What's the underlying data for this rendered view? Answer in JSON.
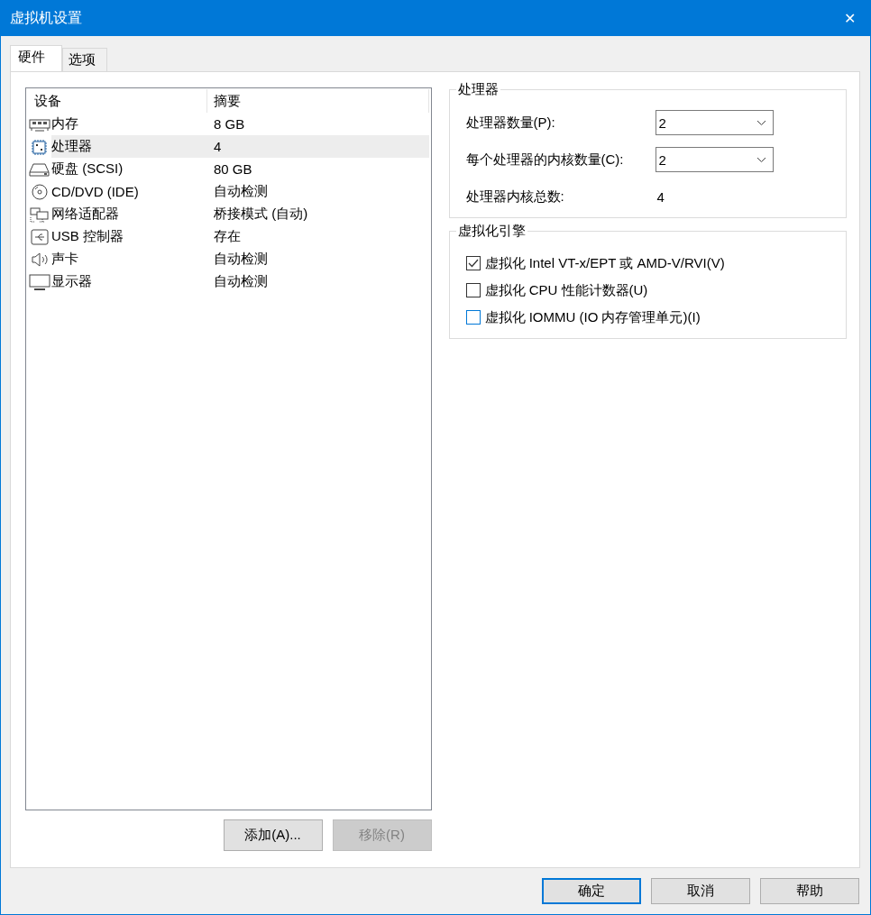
{
  "window": {
    "title": "虚拟机设置",
    "close": "✕"
  },
  "tabs": [
    {
      "label": "硬件",
      "selected": true
    },
    {
      "label": "选项",
      "selected": false
    }
  ],
  "device_table": {
    "columns": [
      "设备",
      "摘要"
    ],
    "rows": [
      {
        "kind": "memory",
        "device": "内存",
        "summary": "8 GB",
        "selected": false
      },
      {
        "kind": "cpu",
        "device": "处理器",
        "summary": "4",
        "selected": true
      },
      {
        "kind": "disk",
        "device": "硬盘 (SCSI)",
        "summary": "80 GB",
        "selected": false
      },
      {
        "kind": "cd",
        "device": "CD/DVD (IDE)",
        "summary": "自动检测",
        "selected": false
      },
      {
        "kind": "network",
        "device": "网络适配器",
        "summary": "桥接模式 (自动)",
        "selected": false
      },
      {
        "kind": "usb",
        "device": "USB 控制器",
        "summary": "存在",
        "selected": false
      },
      {
        "kind": "sound",
        "device": "声卡",
        "summary": "自动检测",
        "selected": false
      },
      {
        "kind": "display",
        "device": "显示器",
        "summary": "自动检测",
        "selected": false
      }
    ]
  },
  "list_buttons": [
    {
      "label": "添加(A)...",
      "disabled": false
    },
    {
      "label": "移除(R)",
      "disabled": true
    }
  ],
  "processor_group": {
    "title": "处理器",
    "fields": [
      {
        "kind": "combo",
        "label": "处理器数量(P):",
        "value": "2"
      },
      {
        "kind": "combo",
        "label": "每个处理器的内核数量(C):",
        "value": "2"
      },
      {
        "kind": "readout",
        "label": "处理器内核总数:",
        "value": "4"
      }
    ]
  },
  "virtualization_group": {
    "title": "虚拟化引擎",
    "options": [
      {
        "label": "虚拟化 Intel VT-x/EPT 或 AMD-V/RVI(V)",
        "checked": true,
        "color": "#333333"
      },
      {
        "label": "虚拟化 CPU 性能计数器(U)",
        "checked": false,
        "color": "#333333"
      },
      {
        "label": "虚拟化 IOMMU (IO 内存管理单元)(I)",
        "checked": false,
        "color": "#0078d7"
      }
    ]
  },
  "dialog_buttons": [
    {
      "label": "确定",
      "default": true
    },
    {
      "label": "取消",
      "default": false
    },
    {
      "label": "帮助",
      "default": false
    }
  ]
}
